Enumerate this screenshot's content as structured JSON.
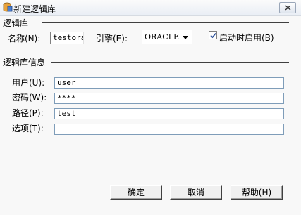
{
  "window": {
    "title": "新建逻辑库"
  },
  "db_group": {
    "title": "逻辑库",
    "name_label": "名称(N):",
    "name_value": "testora",
    "engine_label": "引擎(E):",
    "engine_value": "ORACLE",
    "startup_label": "启动时启用(B)",
    "startup_checked": true
  },
  "info_group": {
    "title": "逻辑库信息",
    "user_label": "用户(U):",
    "user_value": "user",
    "password_label": "密码(W):",
    "password_value": "****",
    "path_label": "路径(P):",
    "path_value": "test",
    "options_label": "选项(T):",
    "options_value": ""
  },
  "buttons": {
    "ok": "确定",
    "cancel": "取消",
    "help": "帮助(H)"
  }
}
